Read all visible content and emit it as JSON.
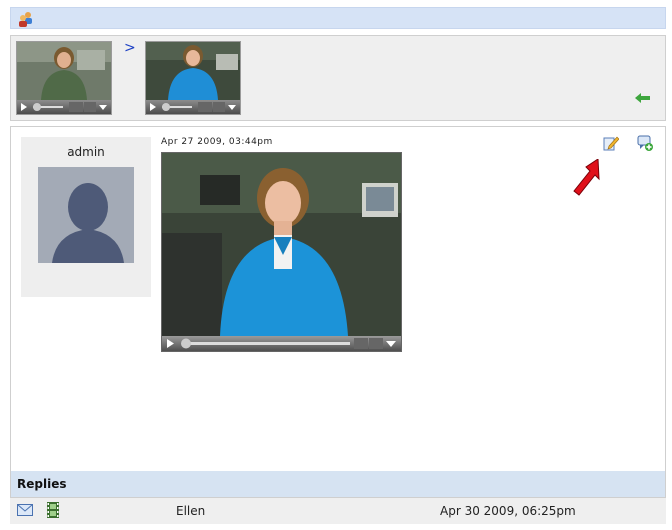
{
  "breadcrumb": {
    "separator": ">"
  },
  "post": {
    "author": "admin",
    "timestamp": "Apr 27 2009, 03:44pm"
  },
  "replies": {
    "header": "Replies",
    "items": [
      {
        "author": "Ellen",
        "date": "Apr 30 2009, 06:25pm"
      }
    ]
  },
  "icons": {
    "topbar": "users-icon",
    "back": "back-arrow-icon",
    "edit": "edit-pencil-icon",
    "reply": "add-comment-icon",
    "mail": "mail-icon",
    "video": "film-icon"
  },
  "colors": {
    "header_bar": "#d6e3f6",
    "annotation_arrow": "#e0101a",
    "link_blue": "#1b3fc4"
  }
}
